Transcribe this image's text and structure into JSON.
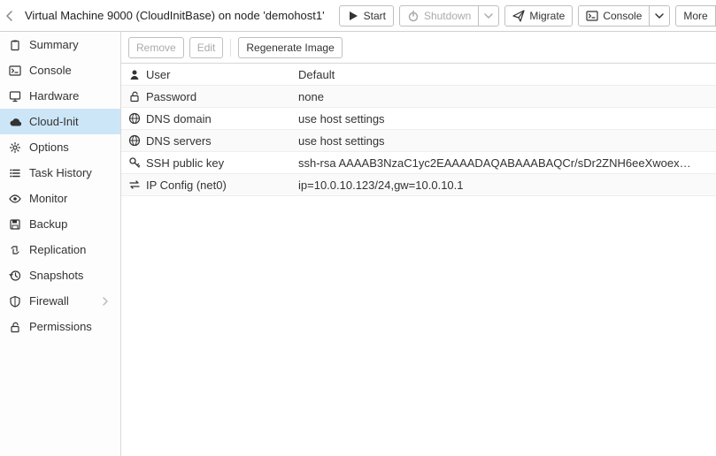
{
  "header": {
    "title": "Virtual Machine 9000 (CloudInitBase) on node 'demohost1'",
    "start_label": "Start",
    "shutdown_label": "Shutdown",
    "migrate_label": "Migrate",
    "console_label": "Console",
    "more_label": "More"
  },
  "sidebar": {
    "items": [
      {
        "label": "Summary",
        "selected": false,
        "icon": "clipboard-icon",
        "expandable": false
      },
      {
        "label": "Console",
        "selected": false,
        "icon": "terminal-icon",
        "expandable": false
      },
      {
        "label": "Hardware",
        "selected": false,
        "icon": "desktop-icon",
        "expandable": false
      },
      {
        "label": "Cloud-Init",
        "selected": true,
        "icon": "cloud-icon",
        "expandable": false
      },
      {
        "label": "Options",
        "selected": false,
        "icon": "gear-icon",
        "expandable": false
      },
      {
        "label": "Task History",
        "selected": false,
        "icon": "list-icon",
        "expandable": false
      },
      {
        "label": "Monitor",
        "selected": false,
        "icon": "eye-icon",
        "expandable": false
      },
      {
        "label": "Backup",
        "selected": false,
        "icon": "save-icon",
        "expandable": false
      },
      {
        "label": "Replication",
        "selected": false,
        "icon": "retweet-icon",
        "expandable": false
      },
      {
        "label": "Snapshots",
        "selected": false,
        "icon": "history-icon",
        "expandable": false
      },
      {
        "label": "Firewall",
        "selected": false,
        "icon": "shield-icon",
        "expandable": true
      },
      {
        "label": "Permissions",
        "selected": false,
        "icon": "unlock-icon",
        "expandable": false
      }
    ]
  },
  "toolbar": {
    "remove_label": "Remove",
    "edit_label": "Edit",
    "regen_label": "Regenerate Image"
  },
  "rows": [
    {
      "icon": "user-icon",
      "key": "User",
      "value": "Default"
    },
    {
      "icon": "unlock-icon",
      "key": "Password",
      "value": "none"
    },
    {
      "icon": "globe-icon",
      "key": "DNS domain",
      "value": "use host settings"
    },
    {
      "icon": "globe-icon",
      "key": "DNS servers",
      "value": "use host settings"
    },
    {
      "icon": "key-icon",
      "key": "SSH public key",
      "value": "ssh-rsa AAAAB3NzaC1yc2EAAAADAQABAAABAQCr/sDr2ZNH6eeXwoex…"
    },
    {
      "icon": "exchange-icon",
      "key": "IP Config (net0)",
      "value": "ip=10.0.10.123/24,gw=10.0.10.1"
    }
  ]
}
